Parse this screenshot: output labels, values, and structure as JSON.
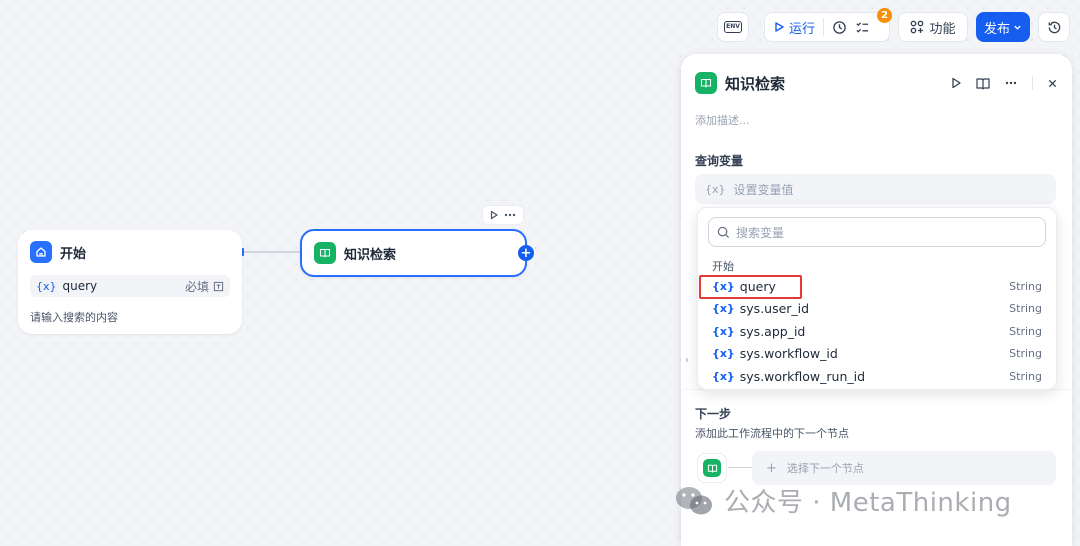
{
  "toolbar": {
    "env_label": "ENV",
    "run_label": "运行",
    "checklist_badge": "2",
    "features_label": "功能",
    "publish_label": "发布"
  },
  "canvas": {
    "start_node": {
      "title": "开始",
      "variable": {
        "name": "query",
        "required_label": "必填"
      },
      "description": "请输入搜索的内容"
    },
    "knowledge_node": {
      "title": "知识检索"
    }
  },
  "panel": {
    "title": "知识检索",
    "add_description": "添加描述...",
    "query_variable_label": "查询变量",
    "set_variable_placeholder": "设置变量值",
    "next_step_title": "下一步",
    "next_step_desc": "添加此工作流程中的下一个节点",
    "select_next_node": "选择下一个节点"
  },
  "dropdown": {
    "search_placeholder": "搜索变量",
    "group_label": "开始",
    "items": [
      {
        "name": "query",
        "type": "String"
      },
      {
        "name": "sys.user_id",
        "type": "String"
      },
      {
        "name": "sys.app_id",
        "type": "String"
      },
      {
        "name": "sys.workflow_id",
        "type": "String"
      },
      {
        "name": "sys.workflow_run_id",
        "type": "String"
      }
    ]
  },
  "watermark": {
    "text": "公众号 · MetaThinking"
  },
  "colors": {
    "primary": "#155eef",
    "start_icon": "#2970ff",
    "knowledge_icon": "#16b364",
    "highlight": "#e53935",
    "badge": "#f79009"
  }
}
